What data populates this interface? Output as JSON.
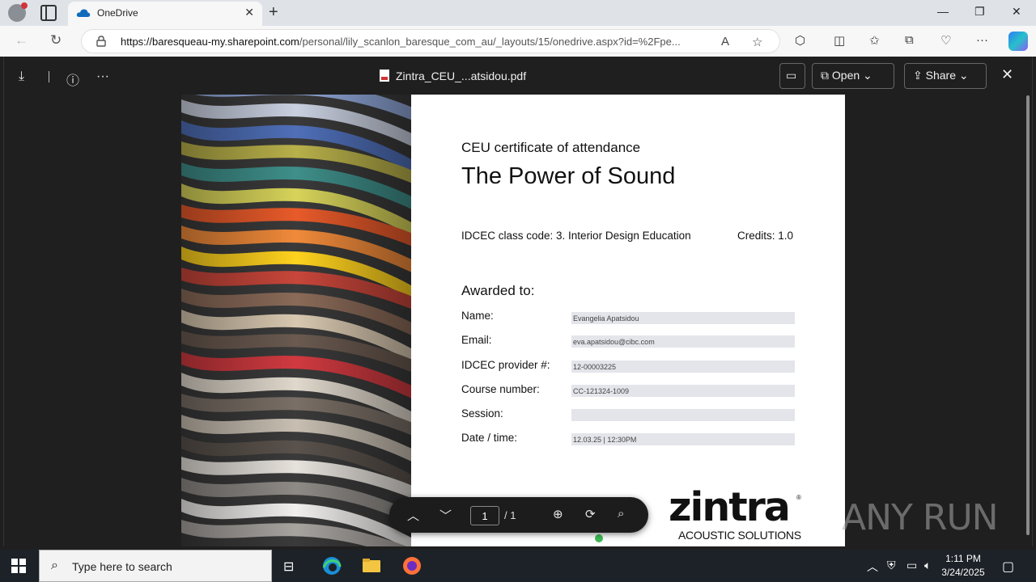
{
  "browser": {
    "tab_title": "OneDrive",
    "url_host": "https://baresqueau-my.sharepoint.com",
    "url_rest": "/personal/lily_scanlon_baresque_com_au/_layouts/15/onedrive.aspx?id=%2Fpe..."
  },
  "viewer": {
    "filename": "Zintra_CEU_...atsidou.pdf",
    "open_label": "Open",
    "share_label": "Share"
  },
  "certificate": {
    "subtitle": "CEU certificate of attendance",
    "title": "The Power of Sound",
    "class_code": "IDCEC class code: 3. Interior Design Education",
    "credits": "Credits: 1.0",
    "awarded_to": "Awarded to:",
    "fields": [
      {
        "label": "Name:",
        "value": "Evangelia Apatsidou"
      },
      {
        "label": "Email:",
        "value": "eva.apatsidou@cibc.com"
      },
      {
        "label": "IDCEC provider #:",
        "value": "12-00003225"
      },
      {
        "label": "Course number:",
        "value": "CC-121324-1009"
      },
      {
        "label": "Session:",
        "value": ""
      },
      {
        "label": "Date / time:",
        "value": "12.03.25  |  12:30PM"
      }
    ],
    "logo_word": "zintra",
    "logo_reg": "®",
    "logo_sub": "ACOUSTIC SOLUTIONS"
  },
  "pagenav": {
    "current": "1",
    "total": "/ 1"
  },
  "watermark": "ANY RUN",
  "taskbar": {
    "search_placeholder": "Type here to search",
    "time": "1:11 PM",
    "date": "3/24/2025"
  }
}
